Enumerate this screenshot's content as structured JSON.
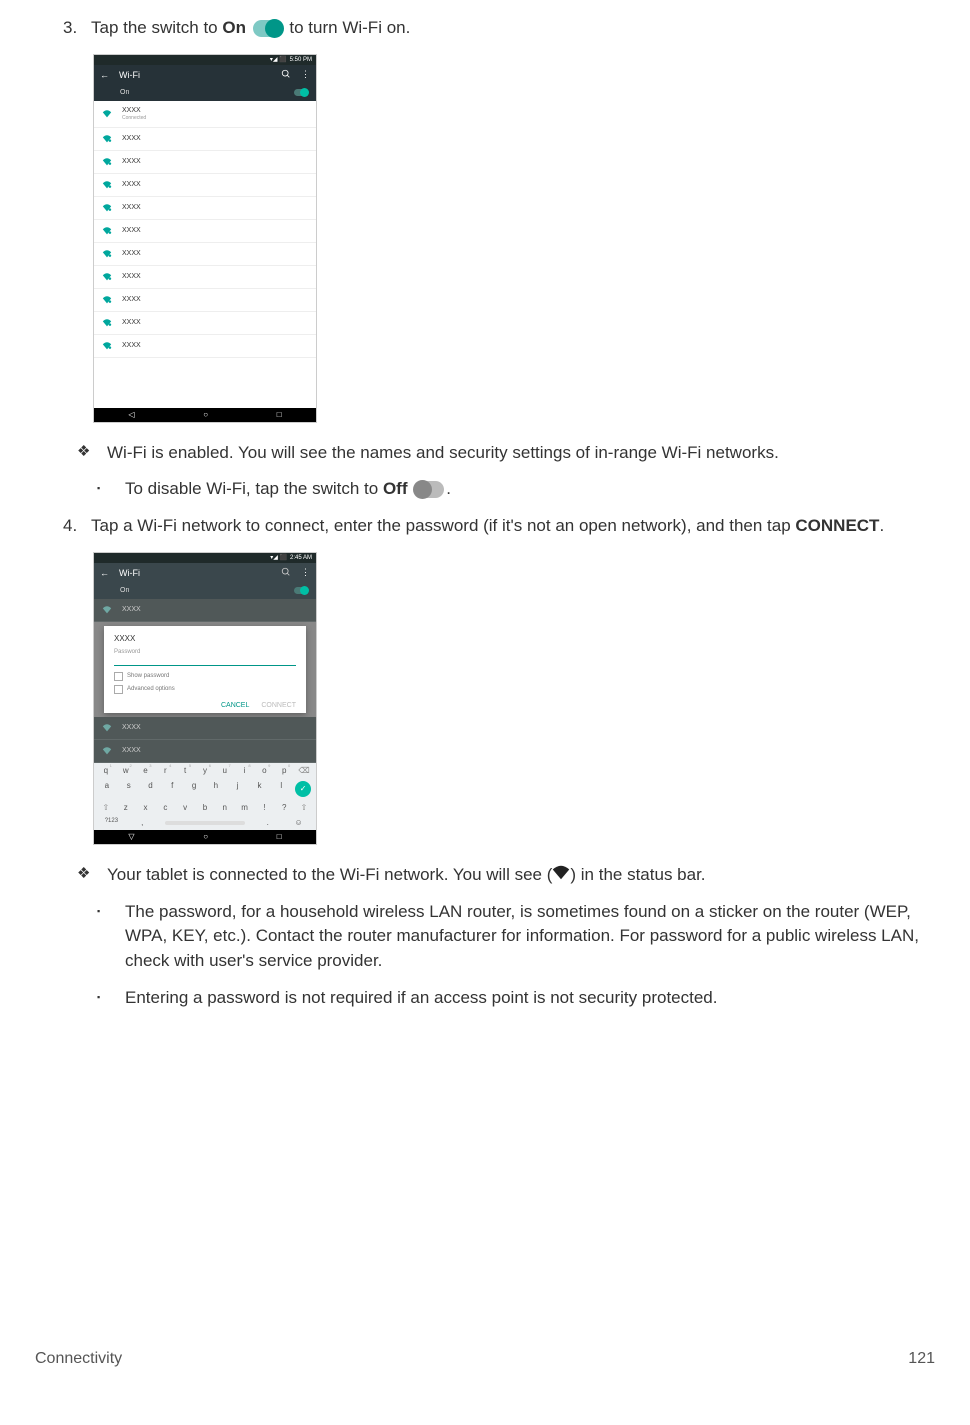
{
  "step3": {
    "num": "3.",
    "text_before": "Tap the switch to ",
    "bold": "On",
    "text_after": " to turn Wi-Fi on."
  },
  "bullet_enabled": "Wi-Fi is enabled. You will see the names and security settings of in-range Wi-Fi networks.",
  "bullet_disable": {
    "before": "To disable Wi-Fi, tap the switch to ",
    "bold": "Off",
    "after": "."
  },
  "step4": {
    "num": "4.",
    "text_before": "Tap a Wi-Fi network to connect, enter the password (if it's not an open network), and then tap ",
    "bold": "CONNECT",
    "text_after": "."
  },
  "bullet_connected": {
    "before": "Your tablet is connected to the Wi-Fi network. You will see (",
    "after": ") in the status bar."
  },
  "bullet_password_info": "The password, for a household wireless LAN router, is sometimes found on a sticker on the router (WEP, WPA, KEY, etc.). Contact the router manufacturer for information. For password for a public wireless LAN, check with user's service provider.",
  "bullet_no_password": "Entering a password is not required if an access point is not security protected.",
  "footer": {
    "section": "Connectivity",
    "page": "121"
  },
  "mock1": {
    "time": "5:50 PM",
    "title": "Wi-Fi",
    "on": "On",
    "connected": "Connected",
    "network": "XXXX",
    "rows": 11
  },
  "mock2": {
    "time": "2:45 AM",
    "title": "Wi-Fi",
    "on": "On",
    "network": "XXXX",
    "dialog": {
      "title": "XXXX",
      "password": "Password",
      "show": "Show password",
      "advanced": "Advanced options",
      "cancel": "CANCEL",
      "connect": "CONNECT"
    },
    "keyboard": {
      "row1": [
        "q",
        "w",
        "e",
        "r",
        "t",
        "y",
        "u",
        "i",
        "o",
        "p"
      ],
      "row1sup": [
        "1",
        "2",
        "3",
        "4",
        "5",
        "6",
        "7",
        "8",
        "9",
        "0"
      ],
      "row2": [
        "a",
        "s",
        "d",
        "f",
        "g",
        "h",
        "j",
        "k",
        "l"
      ],
      "row3": [
        "z",
        "x",
        "c",
        "v",
        "b",
        "n",
        "m",
        "!",
        "?"
      ],
      "sym": "?123"
    }
  }
}
